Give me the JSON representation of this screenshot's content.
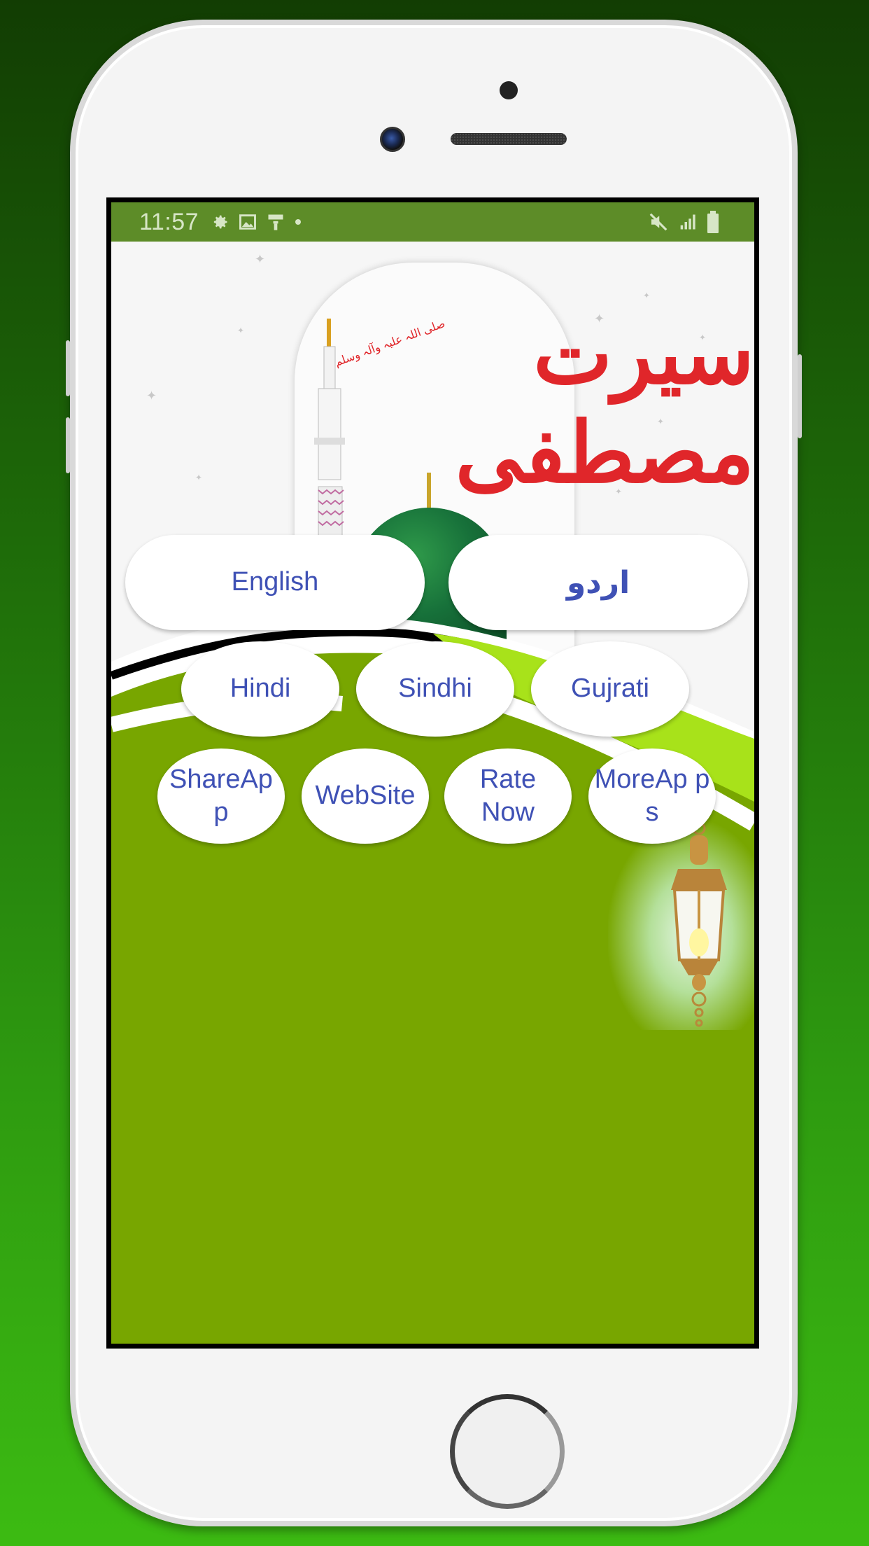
{
  "device": {
    "frame": "white smartphone mockup",
    "background_gradient": [
      "#123d03",
      "#3cbb12"
    ]
  },
  "status_bar": {
    "time": "11:57",
    "left_icons": [
      "settings-icon",
      "image-icon",
      "paint-roller-icon",
      "dot-icon"
    ],
    "right_icons": [
      "mute-icon",
      "signal-icon",
      "battery-icon"
    ],
    "background": "#5d8c28"
  },
  "hero": {
    "title_urdu": "سیرت مصطفی",
    "subtitle_urdu": "صلی اللہ علیہ وآلہ وسلم",
    "title_color": "#e0262a",
    "dome_color": "#17713a"
  },
  "buttons": {
    "row1": [
      {
        "id": "english",
        "label": "English"
      },
      {
        "id": "urdu",
        "label": "اردو"
      }
    ],
    "row2": [
      {
        "id": "hindi",
        "label": "Hindi"
      },
      {
        "id": "sindhi",
        "label": "Sindhi"
      },
      {
        "id": "gujrati",
        "label": "Gujrati"
      }
    ],
    "row3": [
      {
        "id": "share-app",
        "label": "ShareAp p"
      },
      {
        "id": "website",
        "label": "WebSite"
      },
      {
        "id": "rate-now",
        "label": "Rate Now"
      },
      {
        "id": "more-apps",
        "label": "MoreAp ps"
      }
    ],
    "text_color": "#3f51b5"
  },
  "theme": {
    "app_background": "#78a600",
    "swoosh_light": "#a8e21a",
    "swoosh_dark": "#000000"
  }
}
